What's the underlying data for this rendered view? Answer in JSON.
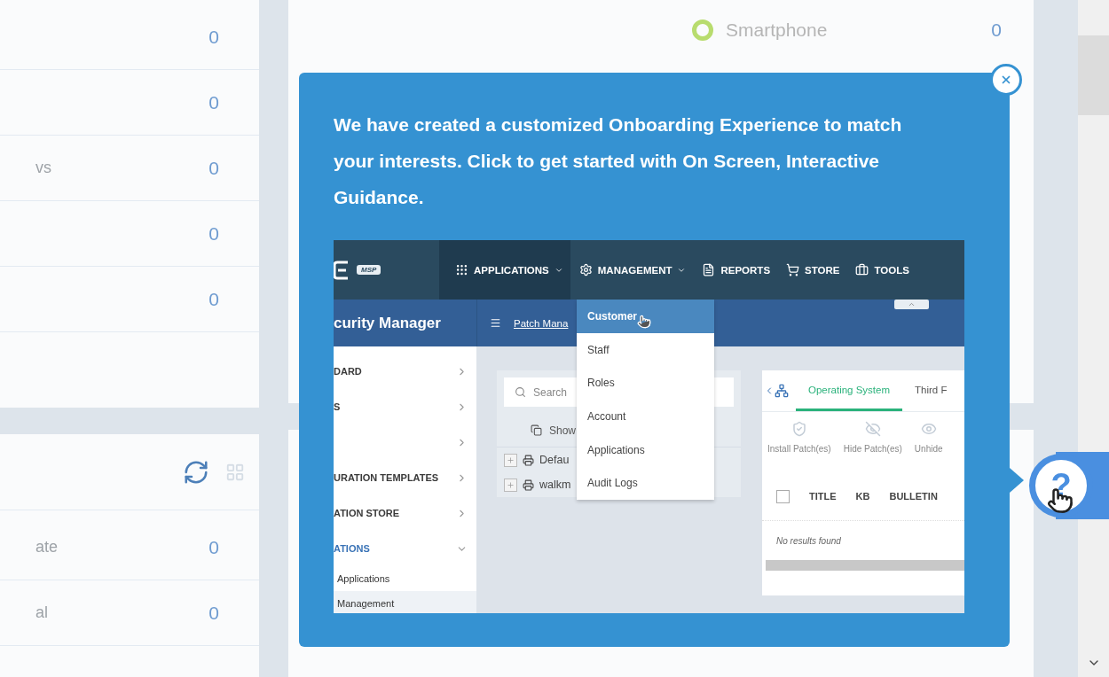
{
  "left_top_rows": [
    {
      "value": "0"
    },
    {
      "value": "0"
    },
    {
      "label": "vs",
      "value": "0"
    },
    {
      "value": "0"
    },
    {
      "value": "0"
    }
  ],
  "left_bottom_rows": [
    {
      "label": "ate",
      "value": "0"
    },
    {
      "label": "al",
      "value": "0"
    }
  ],
  "device_row": {
    "label": "Smartphone",
    "value": "0",
    "color": "#b8dc6e"
  },
  "popup": {
    "message": "We have created a customized Onboarding Experience to match your interests. Click to get started with On Screen, Interactive Guidance.",
    "preview": {
      "logo_badge": "MSP",
      "nav": [
        {
          "label": "APPLICATIONS",
          "selected": true,
          "caret": true
        },
        {
          "label": "MANAGEMENT",
          "selected": false,
          "caret": true
        },
        {
          "label": "REPORTS",
          "selected": false,
          "caret": false
        },
        {
          "label": "STORE",
          "selected": false,
          "caret": false
        },
        {
          "label": "TOOLS",
          "selected": false,
          "caret": false
        }
      ],
      "product_title": "curity Manager",
      "breadcrumb": "Patch Mana",
      "sidebar": [
        {
          "kind": "section",
          "label": "DARD",
          "expanded": false,
          "selected": false
        },
        {
          "kind": "section",
          "label": "S",
          "expanded": false,
          "selected": false
        },
        {
          "kind": "section",
          "expanded": false,
          "selected": false
        },
        {
          "kind": "section",
          "label": "URATION TEMPLATES",
          "expanded": false,
          "selected": false
        },
        {
          "kind": "section",
          "label": "ATION STORE",
          "expanded": false,
          "selected": false
        },
        {
          "kind": "section",
          "label": "ATIONS",
          "expanded": true,
          "selected": false
        },
        {
          "kind": "link",
          "label": "Applications",
          "selected": false
        },
        {
          "kind": "link",
          "label": "Management",
          "selected": true
        }
      ],
      "search_placeholder": "Search",
      "show_label": "Show",
      "tree": [
        {
          "label": "Defau"
        },
        {
          "label": "walkm"
        }
      ],
      "menu": [
        {
          "label": "Customer",
          "selected": true
        },
        {
          "label": "Staff",
          "selected": false
        },
        {
          "label": "Roles",
          "selected": false
        },
        {
          "label": "Account",
          "selected": false
        },
        {
          "label": "Applications",
          "selected": false
        },
        {
          "label": "Audit Logs",
          "selected": false
        }
      ],
      "tabs": [
        {
          "label": "Operating System",
          "selected": true
        },
        {
          "label": "Third F",
          "selected": false
        }
      ],
      "actions": [
        "Install Patch(es)",
        "Hide Patch(es)",
        "Unhide"
      ],
      "columns": [
        "TITLE",
        "KB",
        "BULLETIN"
      ],
      "select_all_checked": false,
      "empty_text": "No results found"
    }
  },
  "help": {
    "label": "?"
  }
}
